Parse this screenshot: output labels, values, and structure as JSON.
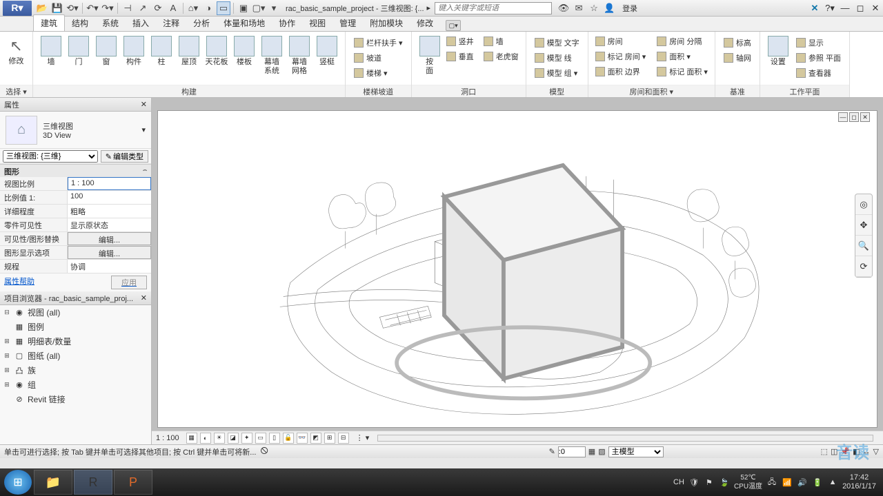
{
  "title": "rac_basic_sample_project - 三维视图: {...",
  "search_placeholder": "键入关键字或短语",
  "login": "登录",
  "menu": {
    "tabs": [
      "建筑",
      "结构",
      "系统",
      "插入",
      "注释",
      "分析",
      "体量和场地",
      "协作",
      "视图",
      "管理",
      "附加模块",
      "修改"
    ],
    "active": 0
  },
  "ribbon": {
    "modify": "修改",
    "select": "选择 ▾",
    "build": {
      "title": "构建",
      "items": [
        "墙",
        "门",
        "窗",
        "构件",
        "柱",
        "屋顶",
        "天花板",
        "楼板",
        "幕墙\n系统",
        "幕墙\n网格",
        "竖梃"
      ]
    },
    "circ": {
      "title": "楼梯坡道",
      "items": [
        "栏杆扶手 ▾",
        "坡道",
        "楼梯 ▾"
      ]
    },
    "open": {
      "title": "洞口",
      "btn": "按\n面",
      "items": [
        "竖井",
        "墙",
        "垂直",
        "老虎窗"
      ]
    },
    "model": {
      "title": "模型",
      "items": [
        "模型 文字",
        "模型 线",
        "模型 组 ▾"
      ]
    },
    "room": {
      "title": "房间和面积 ▾",
      "items": [
        "房间",
        "房间 分隔",
        "标记 房间 ▾",
        "面积 ▾",
        "面积 边界",
        "标记 面积 ▾"
      ]
    },
    "datum": {
      "title": "基准",
      "items": [
        "标高",
        "轴网"
      ]
    },
    "work": {
      "title": "工作平面",
      "btn": "设置",
      "items": [
        "显示",
        "参照 平面",
        "查看器"
      ]
    }
  },
  "props": {
    "title": "属性",
    "type_name": "三维视图",
    "type_sub": "3D View",
    "instance": "三维视图: {三维}",
    "edit_type": "编辑类型",
    "group": "图形",
    "rows": [
      {
        "k": "视图比例",
        "v": "1 : 100"
      },
      {
        "k": "比例值 1:",
        "v": "100"
      },
      {
        "k": "详细程度",
        "v": "粗略"
      },
      {
        "k": "零件可见性",
        "v": "显示原状态"
      },
      {
        "k": "可见性/图形替换",
        "v": "编辑..."
      },
      {
        "k": "图形显示选项",
        "v": "编辑..."
      },
      {
        "k": "规程",
        "v": "协调"
      }
    ],
    "help": "属性帮助",
    "apply": "应用"
  },
  "browser": {
    "title": "项目浏览器 - rac_basic_sample_proj...",
    "items": [
      {
        "exp": "⊟",
        "icon": "◉",
        "label": "视图 (all)"
      },
      {
        "exp": "",
        "icon": "▦",
        "label": "图例"
      },
      {
        "exp": "⊞",
        "icon": "▦",
        "label": "明细表/数量"
      },
      {
        "exp": "⊞",
        "icon": "▢",
        "label": "图纸 (all)"
      },
      {
        "exp": "⊞",
        "icon": "凸",
        "label": "族"
      },
      {
        "exp": "⊞",
        "icon": "◉",
        "label": "组"
      },
      {
        "exp": "",
        "icon": "⊘",
        "label": "Revit 链接"
      }
    ]
  },
  "viewbar": {
    "scale": "1 : 100"
  },
  "status": {
    "hint": "单击可进行选择; 按 Tab 键并单击可选择其他项目; 按 Ctrl 键并单击可将新...",
    "offset": ":0",
    "model": "主模型"
  },
  "tray": {
    "lang": "CH",
    "temp": "52℃",
    "temp_lbl": "CPU温度",
    "time": "17:42",
    "date": "2016/1/17"
  },
  "watermark": "音读"
}
